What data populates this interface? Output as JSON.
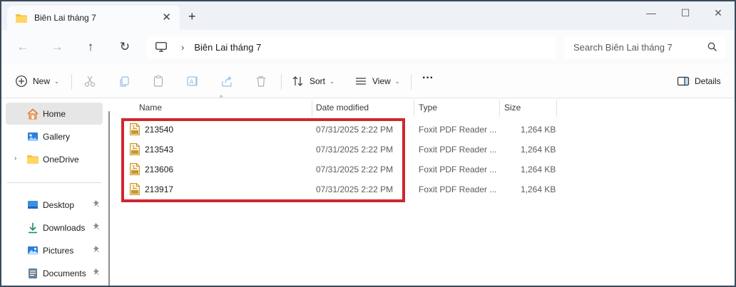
{
  "window": {
    "tab_title": "Biên Lai tháng 7",
    "tab_close": "✕",
    "new_tab": "+",
    "minimize": "—",
    "maximize": "☐",
    "close": "✕"
  },
  "nav": {
    "back": "←",
    "forward": "→",
    "up": "↑",
    "refresh": "↻",
    "breadcrumb_sep": "›",
    "breadcrumb": "Biên Lai tháng 7",
    "search_placeholder": "Search Biên Lai tháng 7"
  },
  "toolbar": {
    "new_label": "New",
    "sort_label": "Sort",
    "view_label": "View",
    "more_label": "···",
    "details_label": "Details",
    "chevron": "⌄"
  },
  "sidebar": {
    "items": [
      {
        "label": "Home",
        "icon": "home-icon"
      },
      {
        "label": "Gallery",
        "icon": "gallery-icon"
      },
      {
        "label": "OneDrive",
        "icon": "folder-icon"
      },
      {
        "label": "Desktop",
        "icon": "desktop-icon"
      },
      {
        "label": "Downloads",
        "icon": "download-icon"
      },
      {
        "label": "Pictures",
        "icon": "pictures-icon"
      },
      {
        "label": "Documents",
        "icon": "documents-icon"
      }
    ],
    "expander": "›",
    "pin": "📌"
  },
  "columns": {
    "name": "Name",
    "date": "Date modified",
    "type": "Type",
    "size": "Size",
    "sort_indicator": "^"
  },
  "files": [
    {
      "name": "213540",
      "date": "07/31/2025 2:22 PM",
      "type": "Foxit PDF Reader ...",
      "size": "1,264 KB"
    },
    {
      "name": "213543",
      "date": "07/31/2025 2:22 PM",
      "type": "Foxit PDF Reader ...",
      "size": "1,264 KB"
    },
    {
      "name": "213606",
      "date": "07/31/2025 2:22 PM",
      "type": "Foxit PDF Reader ...",
      "size": "1,264 KB"
    },
    {
      "name": "213917",
      "date": "07/31/2025 2:22 PM",
      "type": "Foxit PDF Reader ...",
      "size": "1,264 KB"
    }
  ],
  "colors": {
    "highlight": "#d0262f",
    "folder": "#f5c342",
    "pdf": "#c8962c"
  }
}
